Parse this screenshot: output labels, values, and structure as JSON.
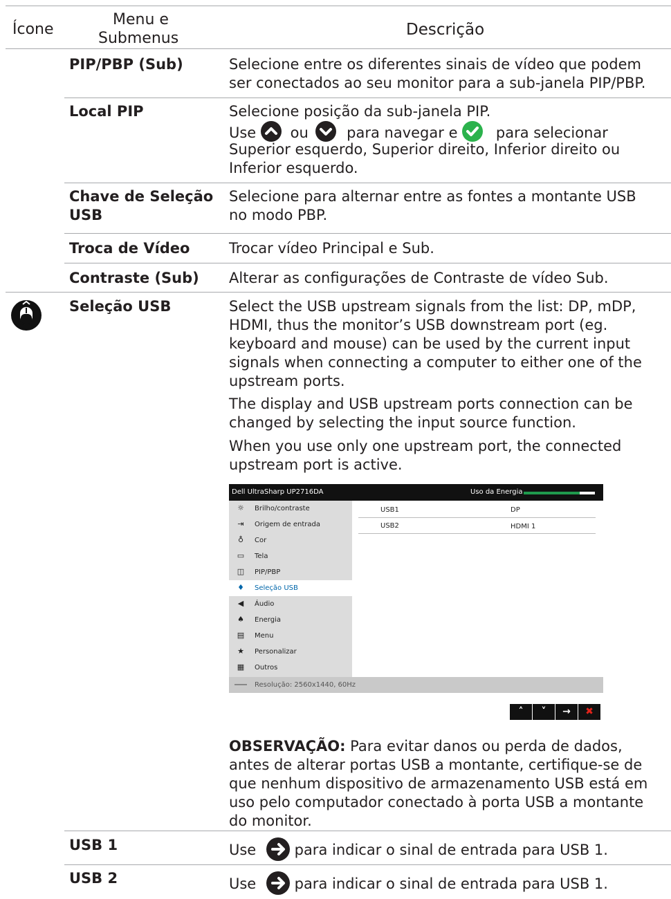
{
  "header": {
    "col_icon": "Ícone",
    "col_menu_line1": "Menu e",
    "col_menu_line2": "Submenus",
    "col_desc": "Descrição"
  },
  "rows": {
    "pip": {
      "menu": "PIP/PBP (Sub)",
      "desc_line1": "Selecione entre os diferentes sinais de vídeo que podem",
      "desc_line2": "ser conectados ao seu monitor para a sub-janela PIP/PBP."
    },
    "local": {
      "menu": "Local PIP",
      "desc_line1": "Selecione posição da sub-janela PIP.",
      "use": "Use",
      "ou": "ou",
      "para_navegar": "para navegar e",
      "para_selecionar": "para selecionar",
      "desc_line3": "Superior esquerdo, Superior direito, Inferior direito ou",
      "desc_line4": "Inferior esquerdo."
    },
    "chave": {
      "menu_line1": "Chave de Seleção",
      "menu_line2": "USB",
      "desc_line1": "Selecione para alternar entre as fontes a montante USB",
      "desc_line2": "no modo PBP."
    },
    "troca": {
      "menu": "Troca de Vídeo",
      "desc": "Trocar vídeo Principal e Sub."
    },
    "contraste": {
      "menu": "Contraste (Sub)",
      "desc": "Alterar as configurações de Contraste de vídeo Sub."
    },
    "selecao": {
      "menu": "Seleção USB",
      "p1_l1": "Select the USB upstream signals from the list: DP, mDP,",
      "p1_l2": "HDMI, thus the monitor’s USB downstream port (eg.",
      "p1_l3": "keyboard and mouse) can be used by the current input",
      "p1_l4": "signals when connecting a computer to either one of the",
      "p1_l5": "upstream ports.",
      "p2_l1": "The display and USB upstream ports connection can be",
      "p2_l2": "changed by selecting the input source function.",
      "p3_l1": "When you use only one upstream port, the connected",
      "p3_l2": "upstream port is active.",
      "note_label": "OBSERVAÇÃO:",
      "note_l1": " Para evitar danos ou perda de dados,",
      "note_l2": "antes de alterar portas USB a montante, certifique-se de",
      "note_l3": "que nenhum dispositivo de armazenamento USB está em",
      "note_l4": "uso pelo computador conectado à porta USB a montante",
      "note_l5": "do monitor."
    },
    "usb1": {
      "menu": "USB 1",
      "use": "Use",
      "desc": "para indicar o sinal de entrada para USB 1."
    },
    "usb2": {
      "menu": "USB 2",
      "use": "Use",
      "desc": "para indicar o sinal de entrada para USB 1."
    }
  },
  "osd": {
    "title": "Dell UltraSharp UP2716DA",
    "energy_label": "Uso da Energia",
    "menu_items": [
      {
        "label": "Brilho/contraste",
        "icon": "sun-icon"
      },
      {
        "label": "Origem de entrada",
        "icon": "input-icon"
      },
      {
        "label": "Cor",
        "icon": "color-icon"
      },
      {
        "label": "Tela",
        "icon": "display-icon"
      },
      {
        "label": "PIP/PBP",
        "icon": "pip-icon"
      },
      {
        "label": "Seleção USB",
        "icon": "usb-icon"
      },
      {
        "label": "Áudio",
        "icon": "speaker-icon"
      },
      {
        "label": "Energia",
        "icon": "power-icon"
      },
      {
        "label": "Menu",
        "icon": "menu-icon"
      },
      {
        "label": "Personalizar",
        "icon": "star-icon"
      },
      {
        "label": "Outros",
        "icon": "others-icon"
      }
    ],
    "selected_item": "Seleção USB",
    "table": [
      {
        "port": "USB1",
        "source": "DP"
      },
      {
        "port": "USB2",
        "source": "HDMI 1"
      }
    ],
    "status": "Resolução: 2560x1440, 60Hz"
  },
  "icons": {
    "row_icon": "usb-selection-mouse-icon",
    "up": "chevron-up-icon",
    "down": "chevron-down-icon",
    "check": "check-icon",
    "arrow": "arrow-right-icon"
  },
  "colors": {
    "green": "#2bb24c",
    "osd_bar": "#1f9a4d",
    "osd_close": "#e2231a"
  }
}
